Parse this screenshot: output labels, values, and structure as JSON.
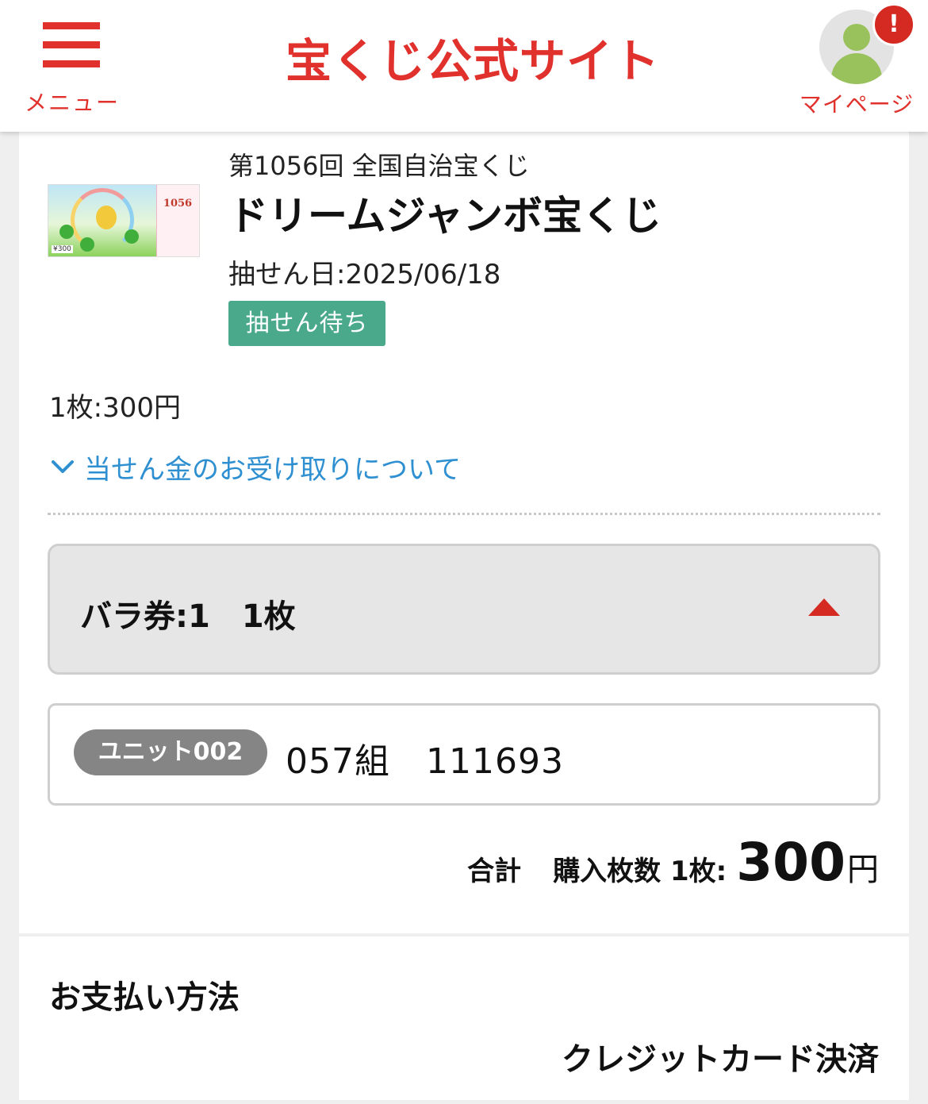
{
  "header": {
    "menu_label": "メニュー",
    "site_title": "宝くじ公式サイト",
    "mypage_label": "マイページ",
    "alert_badge": "!"
  },
  "lottery": {
    "subtitle": "第1056回 全国自治宝くじ",
    "title": "ドリームジャンボ宝くじ",
    "draw_date": "抽せん日:2025/06/18",
    "status": "抽せん待ち",
    "ticket_image_number": "1056",
    "ticket_image_price": "¥300"
  },
  "unit_price": "1枚:300円",
  "prize_link": "当せん金のお受け取りについて",
  "bara": {
    "label": "バラ券:1　1枚"
  },
  "units": [
    {
      "badge": "ユニット002",
      "number": "057組　111693"
    }
  ],
  "total": {
    "label": "合計",
    "count_label": "購入枚数 1枚:",
    "amount": "300",
    "currency": "円"
  },
  "payment": {
    "heading": "お支払い方法",
    "method": "クレジットカード決済"
  },
  "colors": {
    "brand_red": "#e0312d",
    "status_green": "#4aa98b",
    "link_blue": "#2e8fd1",
    "unit_badge_gray": "#858585"
  }
}
